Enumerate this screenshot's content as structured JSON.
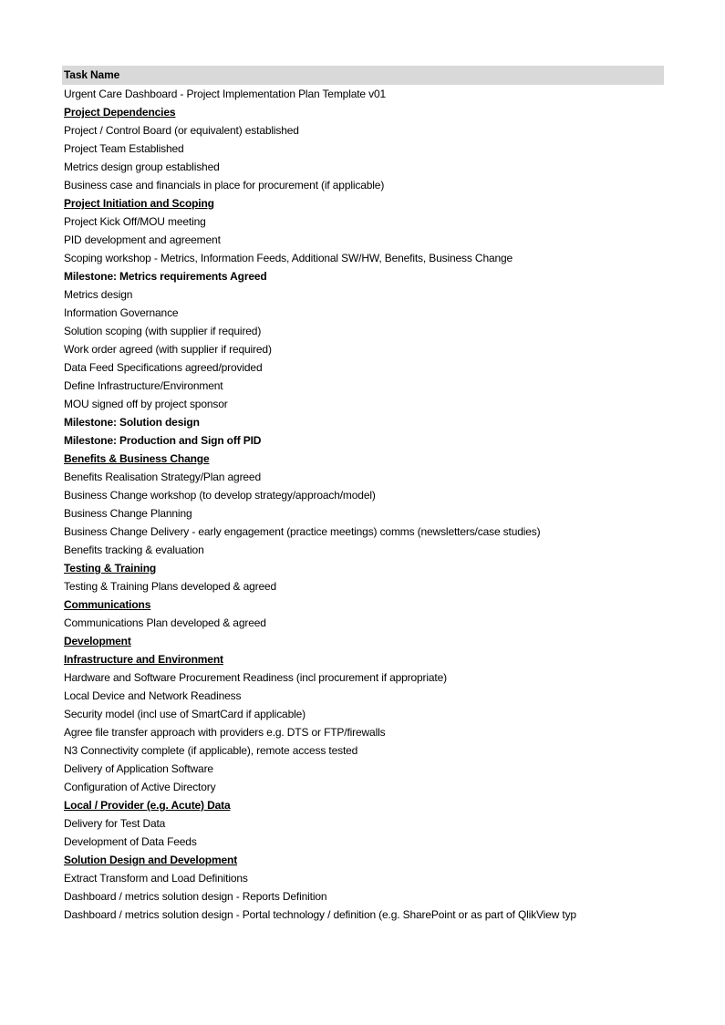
{
  "table": {
    "header": "Task Name",
    "rows": [
      {
        "text": "Urgent Care Dashboard - Project Implementation Plan Template v01",
        "type": "task"
      },
      {
        "text": "Project Dependencies",
        "type": "section"
      },
      {
        "text": "Project / Control Board (or equivalent) established",
        "type": "task"
      },
      {
        "text": "Project Team Established",
        "type": "task"
      },
      {
        "text": "Metrics design group established",
        "type": "task"
      },
      {
        "text": "Business case and financials in place for procurement (if applicable)",
        "type": "task"
      },
      {
        "text": "Project Initiation and Scoping",
        "type": "section"
      },
      {
        "text": "Project Kick Off/MOU meeting",
        "type": "task"
      },
      {
        "text": "PID development and agreement",
        "type": "task"
      },
      {
        "text": "Scoping workshop - Metrics, Information Feeds, Additional SW/HW, Benefits, Business Change",
        "type": "task"
      },
      {
        "text": "Milestone: Metrics requirements Agreed",
        "type": "milestone"
      },
      {
        "text": "Metrics design",
        "type": "task"
      },
      {
        "text": "Information Governance",
        "type": "task"
      },
      {
        "text": "Solution scoping (with supplier if required)",
        "type": "task"
      },
      {
        "text": "Work order agreed (with supplier if required)",
        "type": "task"
      },
      {
        "text": "Data Feed Specifications agreed/provided",
        "type": "task"
      },
      {
        "text": "Define Infrastructure/Environment",
        "type": "task"
      },
      {
        "text": "MOU signed off by project sponsor",
        "type": "task"
      },
      {
        "text": "Milestone: Solution design",
        "type": "milestone"
      },
      {
        "text": "Milestone: Production and Sign off PID",
        "type": "milestone"
      },
      {
        "text": "Benefits & Business Change",
        "type": "section"
      },
      {
        "text": "Benefits Realisation Strategy/Plan agreed",
        "type": "task"
      },
      {
        "text": "Business Change workshop (to develop strategy/approach/model)",
        "type": "task"
      },
      {
        "text": "Business Change Planning",
        "type": "task"
      },
      {
        "text": "Business Change Delivery - early engagement (practice meetings) comms (newsletters/case studies)",
        "type": "task"
      },
      {
        "text": "Benefits tracking & evaluation",
        "type": "task"
      },
      {
        "text": "Testing & Training",
        "type": "section"
      },
      {
        "text": "Testing & Training Plans developed & agreed",
        "type": "task"
      },
      {
        "text": "Communications",
        "type": "section"
      },
      {
        "text": "Communications Plan developed & agreed",
        "type": "task"
      },
      {
        "text": "Development",
        "type": "section"
      },
      {
        "text": "Infrastructure and Environment",
        "type": "section"
      },
      {
        "text": "Hardware and Software Procurement Readiness (incl procurement if appropriate)",
        "type": "task"
      },
      {
        "text": "Local Device and Network Readiness",
        "type": "task"
      },
      {
        "text": "Security model (incl use of SmartCard if applicable)",
        "type": "task"
      },
      {
        "text": "Agree file transfer approach with providers e.g. DTS or FTP/firewalls",
        "type": "task"
      },
      {
        "text": "N3 Connectivity complete (if applicable), remote access tested",
        "type": "task"
      },
      {
        "text": "Delivery of Application Software",
        "type": "task"
      },
      {
        "text": "Configuration of Active Directory",
        "type": "task"
      },
      {
        "text": "Local / Provider (e.g. Acute) Data",
        "type": "section"
      },
      {
        "text": "Delivery for Test Data",
        "type": "task"
      },
      {
        "text": "Development of Data Feeds",
        "type": "task"
      },
      {
        "text": "Solution Design and Development",
        "type": "section"
      },
      {
        "text": "Extract Transform and Load Definitions",
        "type": "task"
      },
      {
        "text": "Dashboard / metrics solution design - Reports Definition",
        "type": "task"
      },
      {
        "text": "Dashboard / metrics solution design - Portal technology / definition (e.g. SharePoint or as part of QlikView typ",
        "type": "task"
      }
    ]
  },
  "colors": {
    "header_bg": "#d9d9d9",
    "text": "#000000"
  }
}
